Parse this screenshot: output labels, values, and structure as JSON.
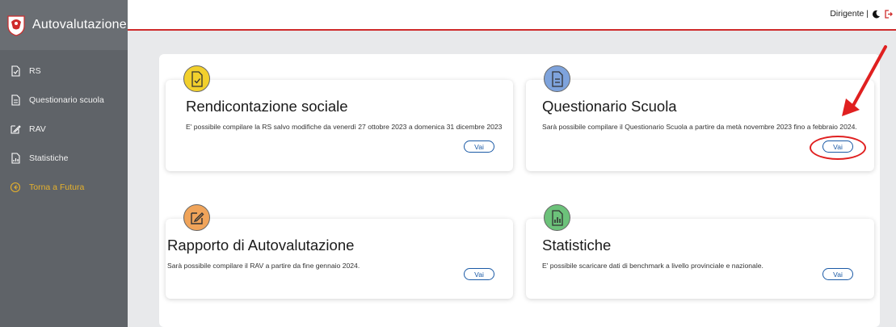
{
  "app": {
    "title": "Autovalutazione"
  },
  "sidebar": {
    "items": [
      {
        "label": "RS",
        "icon": "document-check-icon"
      },
      {
        "label": "Questionario scuola",
        "icon": "document-lines-icon"
      },
      {
        "label": "RAV",
        "icon": "edit-icon"
      },
      {
        "label": "Statistiche",
        "icon": "chart-document-icon"
      },
      {
        "label": "Torna a Futura",
        "icon": "back-circle-icon"
      }
    ]
  },
  "header": {
    "user_role": "Dirigente |"
  },
  "cards": [
    {
      "title": "Rendicontazione sociale",
      "description": "E' possibile compilare la RS salvo modifiche da venerdì 27 ottobre 2023 a domenica 31 dicembre 2023",
      "button": "Vai",
      "icon_color": "#f2d02c"
    },
    {
      "title": "Questionario Scuola",
      "description": "Sarà possibile compilare il Questionario Scuola a partire da metà novembre 2023 fino a febbraio 2024.",
      "button": "Vai",
      "icon_color": "#7ea3dc"
    },
    {
      "title": "Rapporto di Autovalutazione",
      "description": "Sarà possibile compilare il RAV a partire da fine gennaio 2024.",
      "button": "Vai",
      "icon_color": "#f0a45a"
    },
    {
      "title": "Statistiche",
      "description": "E' possibile scaricare dati di benchmark a livello provinciale e nazionale.",
      "button": "Vai",
      "icon_color": "#6cc27a"
    }
  ],
  "colors": {
    "sidebar_bg": "#5f6368",
    "accent_red": "#cf2b2b",
    "link_blue": "#1b5aa6",
    "highlight_yellow": "#e6b12c"
  }
}
